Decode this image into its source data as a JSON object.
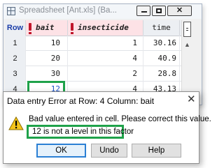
{
  "window": {
    "title": "Spreadsheet [Ant.xls] (Ba..."
  },
  "table": {
    "headers": {
      "row": "Row",
      "bait": "bait",
      "insecticide": "insecticide",
      "time": "time"
    },
    "rows": [
      {
        "row": "1",
        "bait": "10",
        "insecticide": "1",
        "time": "30.16"
      },
      {
        "row": "2",
        "bait": "20",
        "insecticide": "4",
        "time": "40.9"
      },
      {
        "row": "3",
        "bait": "30",
        "insecticide": "2",
        "time": "28.8"
      },
      {
        "row": "4",
        "bait": "12",
        "insecticide": "4",
        "time": "43.13"
      }
    ],
    "selected_cell": {
      "row": "4",
      "column": "bait"
    }
  },
  "dialog": {
    "title": "Data entry Error at Row: 4 Column: bait",
    "message": "Bad value entered in cell.  Please correct this value.",
    "detail": "12 is not a level in this factor",
    "buttons": {
      "ok": "OK",
      "undo": "Undo",
      "help": "Help"
    }
  },
  "colors": {
    "factor_header_bg": "#fde2e6",
    "highlight_border": "#1fa24a",
    "selected_value": "#1f56c9",
    "flag": "#c0162b"
  }
}
